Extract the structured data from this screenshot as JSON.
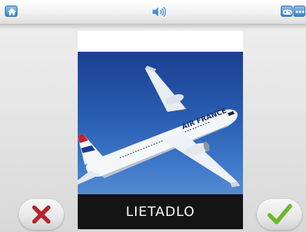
{
  "header": {
    "home_icon": "home-icon",
    "sound_icon": "speaker-icon",
    "game_icon": "gamepad-icon",
    "more_icon": "ellipsis-icon"
  },
  "card": {
    "image_icon": "airplane-photo",
    "airline_livery": "AIR FRANCE",
    "word": "LIETADLO"
  },
  "buttons": {
    "wrong_icon": "cross-icon",
    "right_icon": "checkmark-icon"
  },
  "colors": {
    "accent_blue": "#3a84c6",
    "cross_red": "#b5262c",
    "check_green": "#6cb82a",
    "label_bg": "#141414"
  }
}
